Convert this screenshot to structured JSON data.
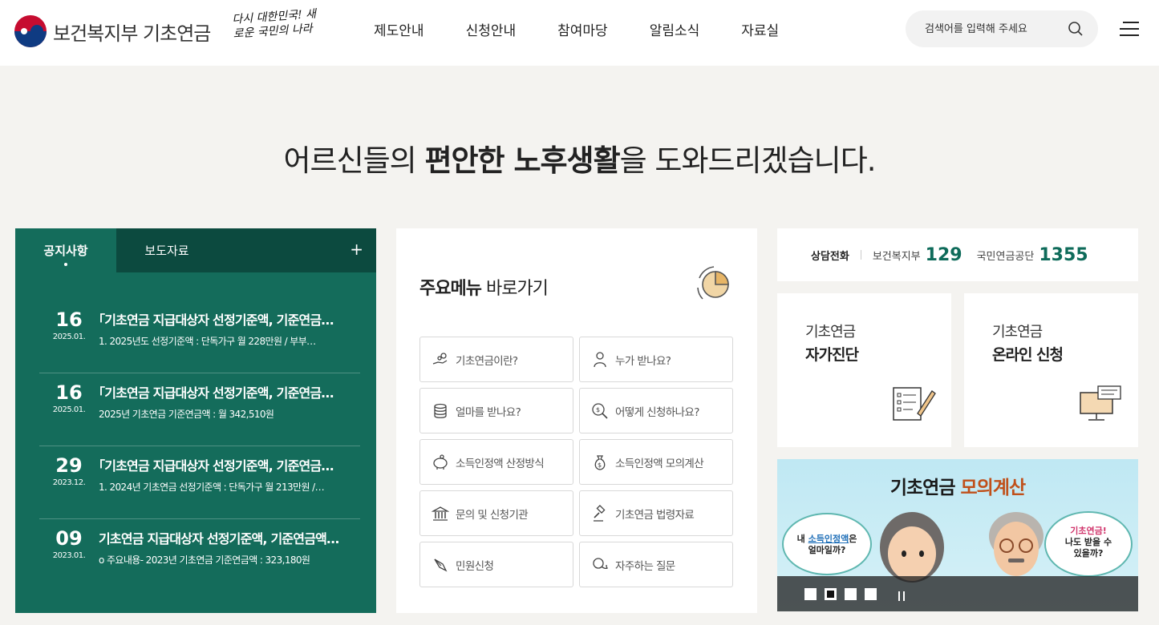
{
  "header": {
    "logo_text": "보건복지부 기초연금",
    "slogan": "다시 대한민국! 새로운 국민의 나라",
    "nav": [
      "제도안내",
      "신청안내",
      "참여마당",
      "알림소식",
      "자료실"
    ],
    "search_placeholder": "검색어를 입력해 주세요"
  },
  "hero": {
    "pre": "어르신들의 ",
    "bold": "편안한 노후생활",
    "post": "을 도와드리겠습니다."
  },
  "notice": {
    "tabs": [
      "공지사항",
      "보도자료"
    ],
    "more": "+",
    "items": [
      {
        "day": "16",
        "ym": "2025.01.",
        "title": "｢기초연금 지급대상자 선정기준액, 기준연금…",
        "desc": "1. 2025년도 선정기준액 : 단독가구 월 228만원 / 부부…"
      },
      {
        "day": "16",
        "ym": "2025.01.",
        "title": "｢기초연금 지급대상자 선정기준액, 기준연금…",
        "desc": "2025년 기초연금 기준연금액 : 월 342,510원"
      },
      {
        "day": "29",
        "ym": "2023.12.",
        "title": "｢기초연금 지급대상자 선정기준액, 기준연금…",
        "desc": "1. 2024년 기초연금 선정기준액 : 단독가구 월 213만원 /…"
      },
      {
        "day": "09",
        "ym": "2023.01.",
        "title": "기초연금 지급대상자 선정기준액, 기준연금액…",
        "desc": "o 주요내용- 2023년 기초연금 기준연금액 : 323,180원"
      }
    ]
  },
  "quick": {
    "title_bold": "주요메뉴",
    "title_rest": " 바로가기",
    "buttons": [
      {
        "label": "기초연금이란?",
        "icon": "hand-coins-icon"
      },
      {
        "label": "누가 받나요?",
        "icon": "person-icon"
      },
      {
        "label": "얼마를 받나요?",
        "icon": "coins-stack-icon"
      },
      {
        "label": "어떻게 신청하나요?",
        "icon": "magnifier-coin-icon"
      },
      {
        "label": "소득인정액 산정방식",
        "icon": "piggy-bank-icon"
      },
      {
        "label": "소득인정액 모의계산",
        "icon": "money-bag-icon"
      },
      {
        "label": "문의 및 신청기관",
        "icon": "bank-building-icon"
      },
      {
        "label": "기초연금 법령자료",
        "icon": "gavel-icon"
      },
      {
        "label": "민원신청",
        "icon": "pen-icon"
      },
      {
        "label": "자주하는 질문",
        "icon": "chat-bubbles-icon"
      }
    ]
  },
  "phone": {
    "label": "상담전화",
    "org1": "보건복지부",
    "num1": "129",
    "org2": "국민연금공단",
    "num2": "1355"
  },
  "cards": [
    {
      "sub": "기초연금",
      "main": "자가진단"
    },
    {
      "sub": "기초연금",
      "main": "온라인 신청"
    }
  ],
  "banner": {
    "title_a": "기초연금 ",
    "title_b": "모의계산",
    "left_1": "내 ",
    "left_hl": "소득인정액",
    "left_2": "은",
    "left_3": "얼마일까?",
    "right_hl": "기초연금!",
    "right_2": "나도 받을 수",
    "right_3": "있을까?",
    "active_slide": 2,
    "slide_count": 4
  }
}
